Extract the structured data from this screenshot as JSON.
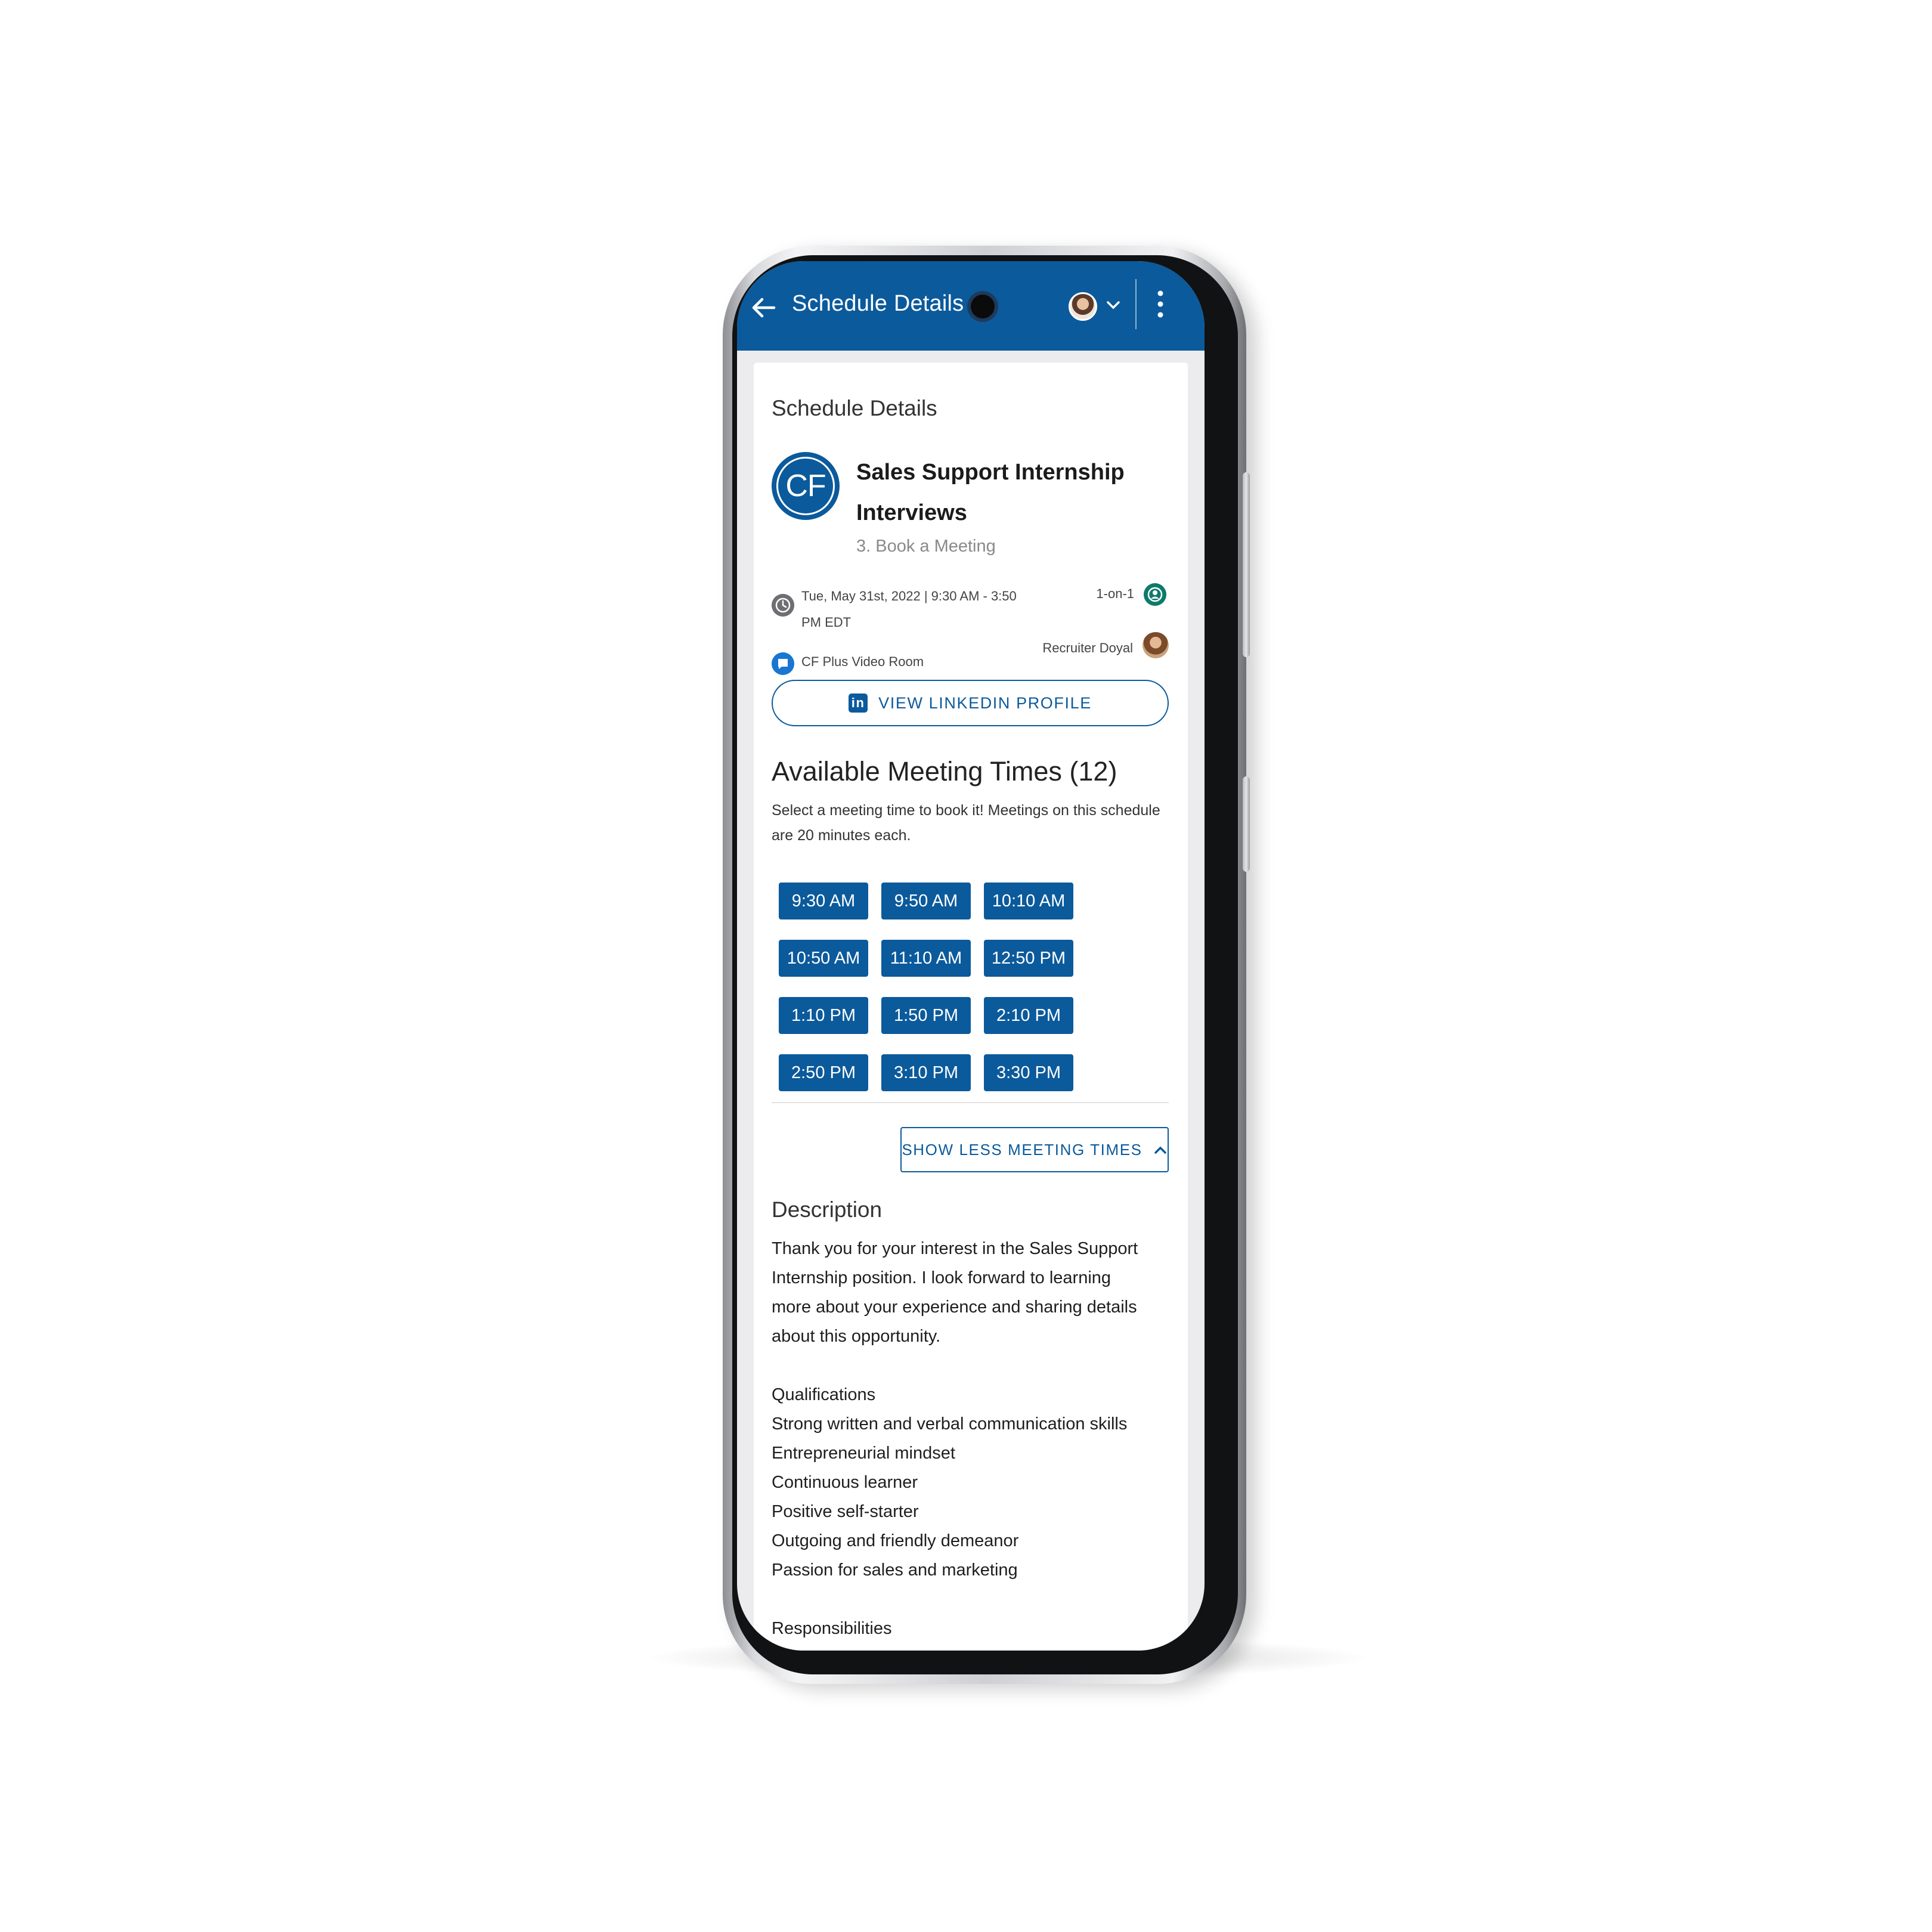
{
  "app_bar": {
    "title": "Schedule Details",
    "accent_color": "#0b5a9c",
    "icons": [
      "arrow-left-icon",
      "avatar",
      "chevron-down-icon",
      "more-vert-icon"
    ]
  },
  "card": {
    "section_title": "Schedule Details",
    "logo_text": "CF",
    "event_title": "Sales Support Internship Interviews",
    "event_subtitle": "3. Book a Meeting",
    "date_time": "Tue, May 31st, 2022 | 9:30 AM - 3:50 PM EDT",
    "room": "CF Plus Video Room",
    "meeting_type": "1-on-1",
    "recruiter": "Recruiter Doyal",
    "linkedin_label": "VIEW LINKEDIN PROFILE",
    "linkedin_icon_text": "in"
  },
  "availability": {
    "title": "Available Meeting Times (12)",
    "description": "Select a meeting time to book it! Meetings on this schedule are 20 minutes each.",
    "slots": [
      "9:30 AM",
      "9:50 AM",
      "10:10 AM",
      "10:50 AM",
      "11:10 AM",
      "12:50 PM",
      "1:10 PM",
      "1:50 PM",
      "2:10 PM",
      "2:50 PM",
      "3:10 PM",
      "3:30 PM"
    ],
    "toggle_label": "SHOW LESS MEETING TIMES"
  },
  "description": {
    "title": "Description",
    "intro": "Thank you for your interest in the Sales Support Internship position. I look forward to learning more about your experience and sharing details about this opportunity.",
    "qualifications_heading": "Qualifications",
    "qualifications": [
      "Strong written and verbal communication skills",
      "Entrepreneurial mindset",
      "Continuous learner",
      "Positive self-starter",
      "Outgoing and friendly demeanor",
      "Passion for sales and marketing"
    ],
    "responsibilities_heading": "Responsibilities"
  }
}
